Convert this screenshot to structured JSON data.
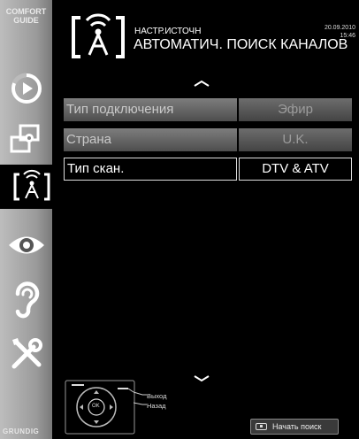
{
  "sidebar": {
    "comfort_line1": "COMFORT",
    "comfort_line2": "GUIDE",
    "brand": "GRUNDIG",
    "icons": [
      "playback-icon",
      "source-icon",
      "antenna-icon",
      "eye-icon",
      "ear-icon",
      "tools-icon"
    ]
  },
  "header": {
    "subtitle": "НАСТР.ИСТОЧН",
    "title": "АВТОМАТИЧ. ПОИСК КАНАЛОВ",
    "date": "20.09.2010",
    "time": "15:46"
  },
  "menu": {
    "rows": [
      {
        "label": "Тип подключения",
        "value": "Эфир",
        "selected": false
      },
      {
        "label": "Страна",
        "value": "U.K.",
        "selected": false
      },
      {
        "label": "Тип скан.",
        "value": "DTV & ATV",
        "selected": true
      }
    ]
  },
  "footer": {
    "exit_label": "Выход",
    "back_label": "Назад",
    "ok_label": "OK",
    "start_label": "Начать поиск"
  }
}
